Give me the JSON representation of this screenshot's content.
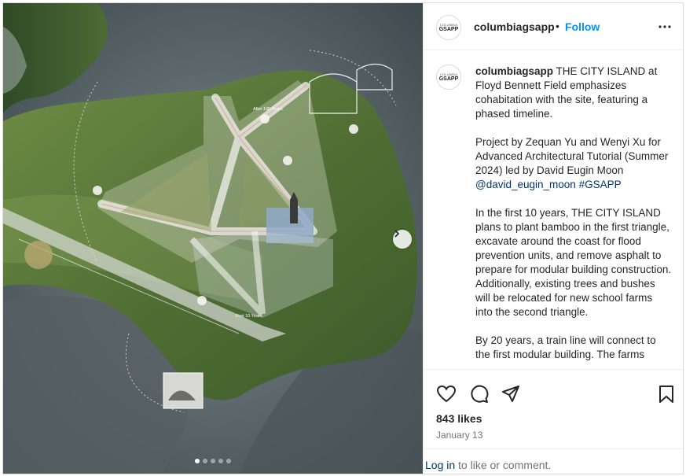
{
  "post": {
    "username": "columbiagsapp",
    "bullet": "•",
    "follow_label": "Follow",
    "avatar_top": "COLUMBIA",
    "avatar_bottom": "GSAPP",
    "caption": {
      "p1": "THE CITY ISLAND at Floyd Bennett Field emphasizes cohabitation with the site, featuring a phased timeline.",
      "p2_text": "Project by Zequan Yu and Wenyi Xu for Advanced Architectural Tutorial (Summer 2024) led by David Eugin Moon ",
      "p2_mention": "@david_eugin_moon",
      "p2_hashtag": "#GSAPP",
      "p3": "In the first 10 years, THE CITY ISLAND plans to plant bamboo in the first triangle, excavate around the coast for flood prevention units, and remove asphalt to prepare for modular building construction. Additionally, existing trees and bushes will be relocated for new school farms into the second triangle.",
      "p4": "By 20 years, a train line will connect to the first modular building. The farms"
    },
    "likes": "843 likes",
    "date": "January 13",
    "login_link": "Log in",
    "login_suffix": " to like or comment."
  },
  "media": {
    "labels": {
      "years_100": "After 100 Years",
      "years_10": "First 10 Years"
    },
    "carousel": {
      "count": 5,
      "active": 0
    }
  },
  "colors": {
    "accent": "#0095f6",
    "link": "#00376b",
    "water": "#5b6a70",
    "land": "#5d7a3e"
  },
  "icons": [
    "more-icon",
    "heart-icon",
    "comment-icon",
    "share-icon",
    "bookmark-icon",
    "chevron-right-icon"
  ]
}
